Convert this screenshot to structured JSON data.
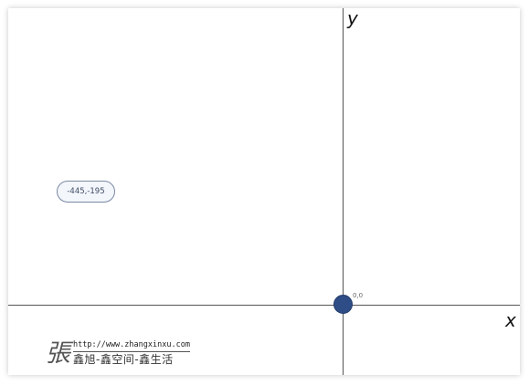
{
  "axes": {
    "x_label": "x",
    "y_label": "y"
  },
  "origin": {
    "label": "0,0",
    "color": "#2e4d86"
  },
  "pointer_coordinates": {
    "text": "-445,-195"
  },
  "watermark": {
    "glyph": "張",
    "url": "http://www.zhangxinxu.com",
    "tagline": "鑫旭-鑫空间-鑫生活"
  }
}
